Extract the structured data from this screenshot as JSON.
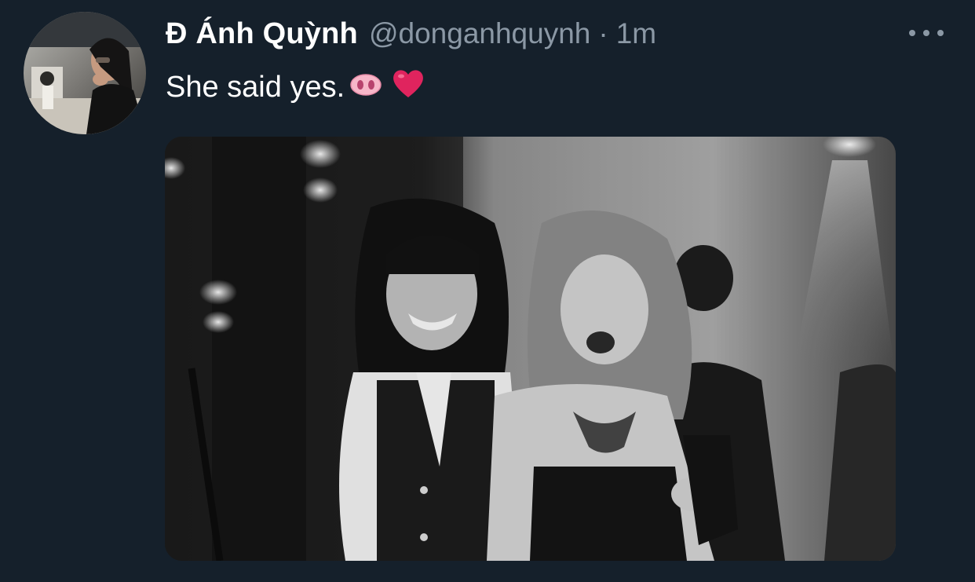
{
  "tweet": {
    "display_name": "Đ Ánh Quỳnh",
    "handle": "@donganhquynh",
    "separator": "·",
    "timestamp": "1m",
    "text": "She said yes.",
    "emojis": [
      "pig-nose-emoji",
      "red-heart-emoji"
    ],
    "more_icon": "more-horizontal-icon",
    "media": {
      "type": "photo",
      "style": "black-and-white"
    }
  },
  "colors": {
    "background": "#15202b",
    "primary_text": "#ffffff",
    "secondary_text": "#8b98a5",
    "heart": "#e0245e",
    "pig_nose": "#f7b6c8"
  }
}
